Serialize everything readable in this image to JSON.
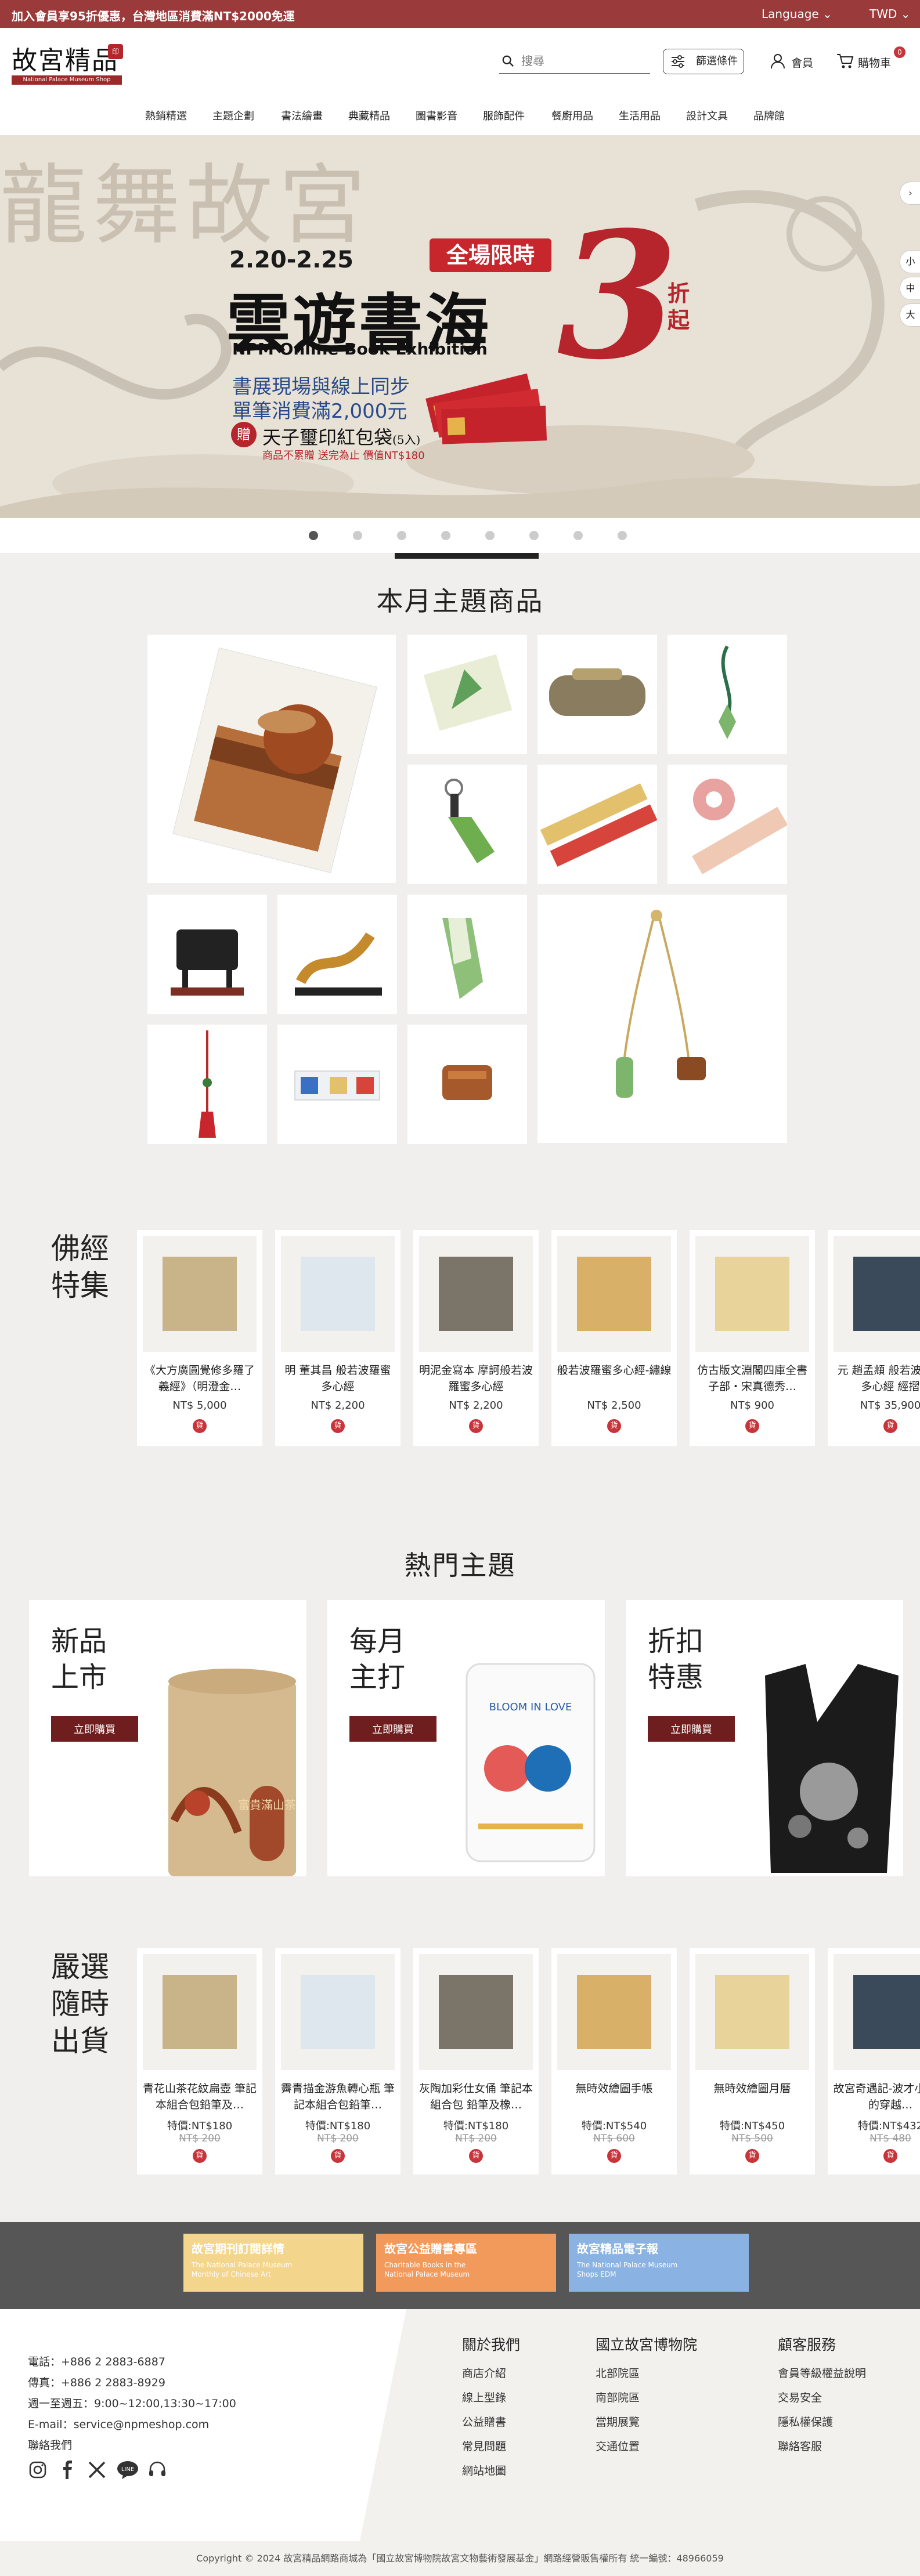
{
  "topbar": {
    "promo": "加入會員享95折優惠，台灣地區消費滿NT$2000免運",
    "language": "Language",
    "currency": "TWD"
  },
  "header": {
    "logo_cn": "故宮精品",
    "logo_en": "National Palace Museum Shop",
    "logo_seal": "印",
    "search_placeholder": "搜尋",
    "filter_label": "篩選條件",
    "member_label": "會員",
    "cart_label": "購物車",
    "cart_count": "0"
  },
  "nav": [
    "熱銷精選",
    "主題企劃",
    "書法繪畫",
    "典藏精品",
    "圖書影音",
    "服飾配件",
    "餐廚用品",
    "生活用品",
    "設計文具",
    "品牌館"
  ],
  "hero": {
    "background_calligraphy": "龍舞故宮",
    "date": "2.20-2.25",
    "badge": "全場限時",
    "title": "雲遊書海",
    "discount_number": "3",
    "discount_word": "折起",
    "subtitle_en": "NPM Online Book Exhibition",
    "line1": "書展現場與線上同步",
    "line2": "單筆消費滿2,000元",
    "gift_icon": "贈",
    "gift": "天子璽印紅包袋",
    "gift_qty": "(5入)",
    "gift_note": "商品不累贈 送完為止 價值NT$180",
    "side_controls": [
      "小",
      "中",
      "大"
    ],
    "active_slide": 0,
    "slide_count": 8
  },
  "monthly": {
    "title": "本月主題商品"
  },
  "buddhist": {
    "title": "佛經特集",
    "title_lines": [
      "佛經",
      "特集"
    ],
    "items": [
      {
        "name": "《大方廣圓覺修多羅了義經》（明澄金…",
        "price": "NT$ 5,000",
        "tag": "貨"
      },
      {
        "name": "明 董其昌 般若波羅蜜多心經",
        "price": "NT$ 2,200",
        "tag": "貨"
      },
      {
        "name": "明泥金寫本 摩訶般若波羅蜜多心經",
        "price": "NT$ 2,200",
        "tag": "貨"
      },
      {
        "name": "般若波羅蜜多心經-繡線",
        "price": "NT$ 2,500",
        "tag": "貨"
      },
      {
        "name": "仿古版文淵閣四庫全書 子部・宋真德秀…",
        "price": "NT$ 900",
        "tag": "貨"
      },
      {
        "name": "元 趙孟頫 般若波羅蜜多心經 經摺",
        "price": "NT$ 35,900",
        "tag": "貨"
      }
    ]
  },
  "hot": {
    "title": "熱門主題",
    "cards": [
      {
        "title_lines": [
          "新品",
          "上市"
        ],
        "button": "立即購買",
        "product_label": "富貴滿山茶"
      },
      {
        "title_lines": [
          "每月",
          "主打"
        ],
        "button": "立即購買",
        "product_label": "BLOOM IN LOVE"
      },
      {
        "title_lines": [
          "折扣",
          "特惠"
        ],
        "button": "立即購買"
      }
    ]
  },
  "ready": {
    "title_lines": [
      "嚴選",
      "隨時",
      "出貨"
    ],
    "items": [
      {
        "name": "青花山茶花紋扁壺 筆記本組合包鉛筆及…",
        "sale": "特價:NT$180",
        "orig": "NT$ 200",
        "tag": "貨"
      },
      {
        "name": "霽青描金游魚轉心瓶 筆記本組合包鉛筆…",
        "sale": "特價:NT$180",
        "orig": "NT$ 200",
        "tag": "貨"
      },
      {
        "name": "灰陶加彩仕女俑 筆記本組合包 鉛筆及橡…",
        "sale": "特價:NT$180",
        "orig": "NT$ 200",
        "tag": "貨"
      },
      {
        "name": "無時效繪圖手帳",
        "sale": "特價:NT$540",
        "orig": "NT$ 600",
        "tag": "貨"
      },
      {
        "name": "無時效繪圖月曆",
        "sale": "特價:NT$450",
        "orig": "NT$ 500",
        "tag": "貨"
      },
      {
        "name": "故宮奇遇記-波才小英雄的穿越…",
        "sale": "特價:NT$432",
        "orig": "NT$ 480",
        "tag": "貨"
      }
    ]
  },
  "banners": [
    {
      "title": "故宮期刊訂閱詳情",
      "sub": "The National Palace Museum Monthly of Chinese Art",
      "color": "#f3d58c"
    },
    {
      "title": "故宮公益贈書專區",
      "sub": "Charitable Books in the National Palace Museum",
      "color": "#f29a5c"
    },
    {
      "title": "故宮精品電子報",
      "sub": "The National Palace Museum Shops EDM",
      "color": "#8ab3e3"
    }
  ],
  "footer": {
    "phone": "電話：+886 2 2883-6887",
    "fax": "傳真：+886 2 2883-8929",
    "hours": "週一至週五：9:00~12:00,13:30~17:00",
    "email": "E-mail：service@npmeshop.com",
    "contact": "聯絡我們",
    "cols": [
      {
        "title": "關於我們",
        "links": [
          "商店介紹",
          "線上型錄",
          "公益贈書",
          "常見問題",
          "網站地圖"
        ]
      },
      {
        "title": "國立故宮博物院",
        "links": [
          "北部院區",
          "南部院區",
          "當期展覽",
          "交通位置"
        ]
      },
      {
        "title": "顧客服務",
        "links": [
          "會員等級權益說明",
          "交易安全",
          "隱私權保護",
          "聯絡客服"
        ]
      }
    ],
    "copyright": "Copyright © 2024 故宮精品網路商城為「國立故宮博物院故宮文物藝術發展基金」網路經營販售權所有 統一編號：48966059"
  },
  "colors": {
    "topbar": "#9b3a3a",
    "accent": "#c7353a",
    "button_dark": "#6e1e1e",
    "page_bg": "#f0efed"
  }
}
